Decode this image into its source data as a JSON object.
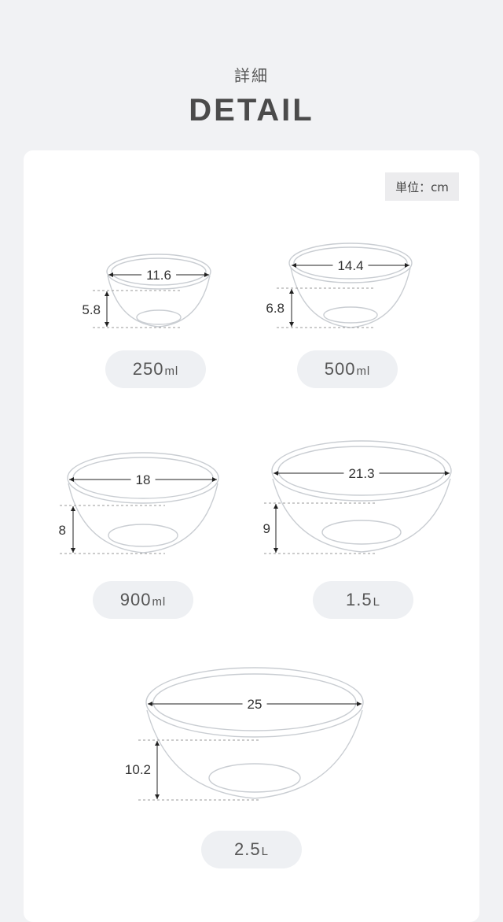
{
  "header": {
    "subtitle": "詳細",
    "title": "DETAIL"
  },
  "unit_label": "単位：cm",
  "bowls": [
    {
      "width": "11.6",
      "height": "5.8",
      "capacity_value": "250",
      "capacity_unit": "ml"
    },
    {
      "width": "14.4",
      "height": "6.8",
      "capacity_value": "500",
      "capacity_unit": "ml"
    },
    {
      "width": "18",
      "height": "8",
      "capacity_value": "900",
      "capacity_unit": "ml"
    },
    {
      "width": "21.3",
      "height": "9",
      "capacity_value": "1.5",
      "capacity_unit": "L"
    },
    {
      "width": "25",
      "height": "10.2",
      "capacity_value": "2.5",
      "capacity_unit": "L"
    }
  ]
}
